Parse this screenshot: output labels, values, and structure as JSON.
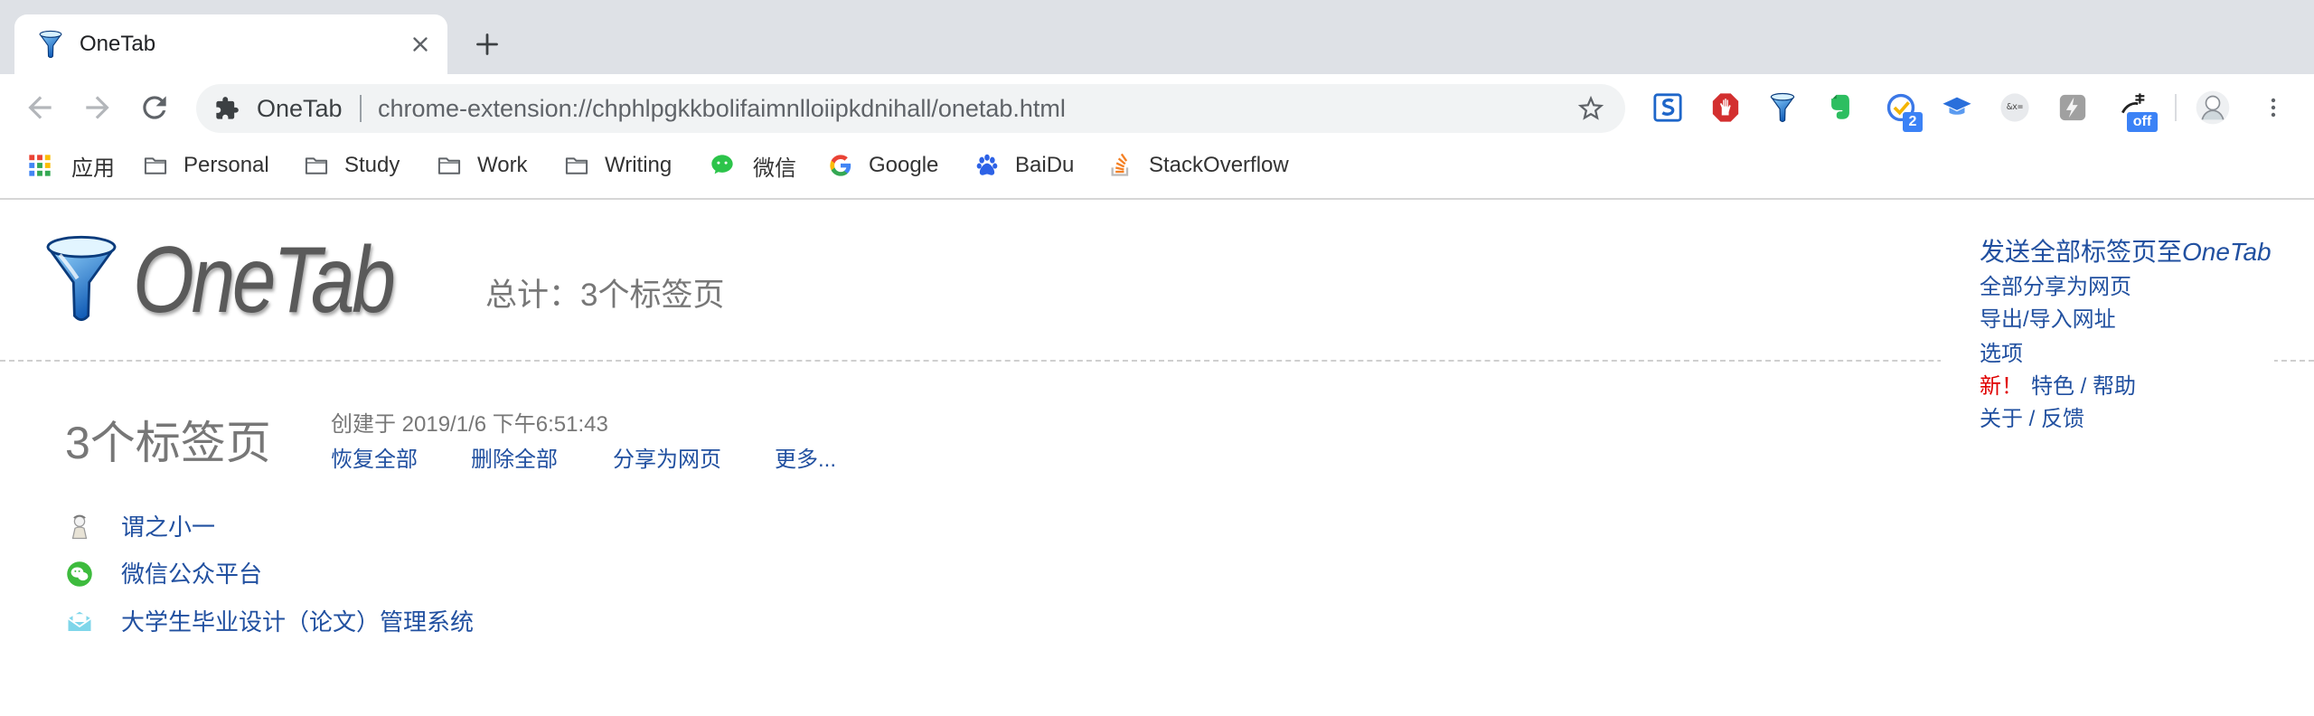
{
  "browser": {
    "tab": {
      "title": "OneTab",
      "favicon": "onetab-funnel-icon",
      "close_icon": "close-icon"
    },
    "new_tab_icon": "plus-icon",
    "nav": {
      "back_icon": "back-arrow-icon",
      "forward_icon": "forward-arrow-icon",
      "reload_icon": "reload-icon"
    },
    "omnibox": {
      "site_icon": "puzzle-piece-icon",
      "site_name": "OneTab",
      "url": "chrome-extension://chphlpgkkbolifaimnlloiipkdnihall/onetab.html",
      "bookmark_icon": "star-icon"
    },
    "extensions": [
      {
        "icon": "sogou-s-icon"
      },
      {
        "icon": "adblock-hand-icon"
      },
      {
        "icon": "onetab-funnel-icon"
      },
      {
        "icon": "evernote-elephant-icon"
      },
      {
        "icon": "task-check-icon",
        "badge": "2"
      },
      {
        "icon": "graduation-cap-icon"
      },
      {
        "icon": "url-encode-icon",
        "label": "&x="
      },
      {
        "icon": "lightning-icon"
      },
      {
        "icon": "dictionary-pen-icon",
        "badge": "off"
      }
    ],
    "profile_icon": "avatar-icon",
    "menu_icon": "more-vertical-icon"
  },
  "bookmarks": [
    {
      "label": "应用",
      "icon": "apps-grid-icon"
    },
    {
      "label": "Personal",
      "icon": "folder-icon"
    },
    {
      "label": "Study",
      "icon": "folder-icon"
    },
    {
      "label": "Work",
      "icon": "folder-icon"
    },
    {
      "label": "Writing",
      "icon": "folder-icon"
    },
    {
      "label": "微信",
      "icon": "wechat-icon"
    },
    {
      "label": "Google",
      "icon": "google-g-icon"
    },
    {
      "label": "BaiDu",
      "icon": "baidu-paw-icon"
    },
    {
      "label": "StackOverflow",
      "icon": "stackoverflow-icon"
    }
  ],
  "page": {
    "logo": {
      "icon": "onetab-funnel-icon",
      "text": "OneTab"
    },
    "total": "总计：3个标签页",
    "menu": {
      "send_all_prefix": "发送全部标签页至",
      "send_all_brand": "OneTab",
      "share_all": "全部分享为网页",
      "export_import": "导出/导入网址",
      "options": "选项",
      "new_badge": "新！",
      "features_help": "特色 / 帮助",
      "about_feedback": "关于 / 反馈"
    },
    "group": {
      "count": "3个标签页",
      "created": "创建于 2019/1/6 下午6:51:43",
      "actions": {
        "restore_all": "恢复全部",
        "delete_all": "删除全部",
        "share_as_web": "分享为网页",
        "more": "更多..."
      },
      "tabs": [
        {
          "title": "谓之小一",
          "icon": "cartoon-avatar-icon"
        },
        {
          "title": "微信公众平台",
          "icon": "wechat-icon"
        },
        {
          "title": "大学生毕业设计（论文）管理系统",
          "icon": "graduation-system-icon"
        }
      ]
    }
  },
  "colors": {
    "link": "#2150a0",
    "muted": "#777777",
    "newred": "#e00000",
    "strip": "#dee1e6",
    "omni": "#f1f3f4",
    "badge": "#3b82f6"
  }
}
